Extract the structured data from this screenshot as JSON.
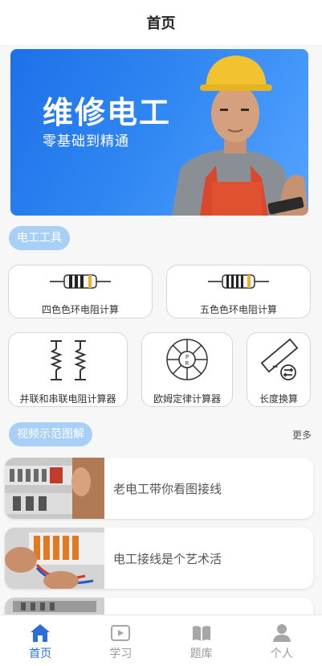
{
  "header": {
    "title": "首页"
  },
  "banner": {
    "headline": "维修电工",
    "subline": "零基础到精通"
  },
  "tools_section": {
    "title": "电工工具"
  },
  "tools": [
    {
      "label": "四色色环电阻计算",
      "icon": "resistor-4band-icon"
    },
    {
      "label": "五色色环电阻计算",
      "icon": "resistor-5band-icon"
    },
    {
      "label": "并联和串联电阻计算器",
      "icon": "series-parallel-resistor-icon"
    },
    {
      "label": "欧姆定律计算器",
      "icon": "ohms-law-wheel-icon"
    },
    {
      "label": "长度换算",
      "icon": "ruler-convert-icon"
    }
  ],
  "videos_section": {
    "title": "视频示范图解",
    "more_label": "更多"
  },
  "videos": [
    {
      "title": "老电工带你看图接线"
    },
    {
      "title": "电工接线是个艺术活"
    },
    {
      "title": ""
    }
  ],
  "tabbar": {
    "items": [
      {
        "label": "首页",
        "icon": "home-icon",
        "active": true
      },
      {
        "label": "学习",
        "icon": "play-icon",
        "active": false
      },
      {
        "label": "题库",
        "icon": "book-icon",
        "active": false
      },
      {
        "label": "个人",
        "icon": "person-icon",
        "active": false
      }
    ]
  },
  "colors": {
    "accent": "#2a6fd6",
    "pill": "#a8d0f7",
    "banner": "#2f86f2"
  }
}
